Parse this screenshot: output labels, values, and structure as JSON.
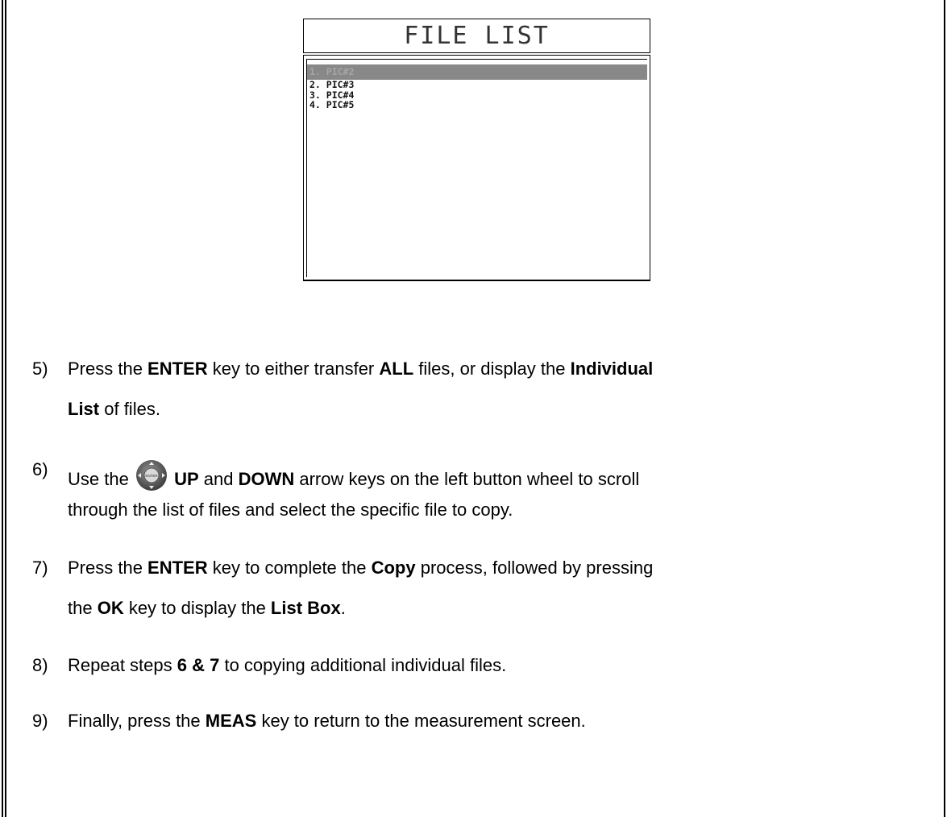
{
  "device_screen": {
    "title": "FILE LIST",
    "items": [
      {
        "label": "1. PIC#2",
        "selected": true
      },
      {
        "label": "2. PIC#3",
        "selected": false
      },
      {
        "label": "3. PIC#4",
        "selected": false
      },
      {
        "label": "4. PIC#5",
        "selected": false
      }
    ]
  },
  "steps": [
    {
      "number": "5)",
      "line1": [
        "Press the ",
        "ENTER",
        " key to either transfer ",
        "ALL",
        " files, or display the ",
        "Individual"
      ],
      "line2": [
        "List",
        " of files."
      ]
    },
    {
      "number": "6)",
      "line1_before_icon": "Use the",
      "line1_after_icon": [
        " UP",
        " and ",
        "DOWN",
        " arrow keys on the left button wheel to scroll"
      ],
      "line2": "through the list of files and select the specific file to copy.",
      "icon": "button-wheel-icon"
    },
    {
      "number": "7)",
      "line1": [
        "Press the ",
        "ENTER",
        " key to complete the ",
        "Copy",
        " process, followed by pressing"
      ],
      "line2": [
        "the ",
        "OK",
        " key to display the ",
        "List Box",
        "."
      ]
    },
    {
      "number": "8)",
      "line1": [
        "Repeat steps ",
        "6 & 7",
        " to copying additional individual files."
      ]
    },
    {
      "number": "9)",
      "line1": [
        "Finally, press the ",
        "MEAS",
        " key to return to the measurement screen."
      ]
    }
  ]
}
